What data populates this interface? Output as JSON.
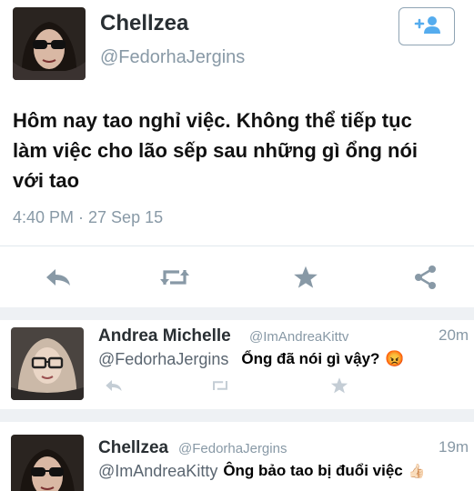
{
  "main_tweet": {
    "author_name": "Chellzea",
    "author_handle": "@FedorhaJergins",
    "text_line1": "Hôm nay tao nghỉ việc. Không thể tiếp tục",
    "text_line2": "làm việc cho lão sếp sau những gì ổng nói",
    "text_line3": "với tao",
    "timestamp": "4:40 PM · 27 Sep 15",
    "follow_icon": "plus-user-icon",
    "actions": [
      "reply-icon",
      "retweet-icon",
      "favorite-icon",
      "share-icon"
    ]
  },
  "replies": [
    {
      "author_name": "Andrea Michelle",
      "author_handle": "@ImAndreaKittv",
      "time": "20m",
      "mention": "@FedorhaJergins",
      "caption": "Ổng đã nói gì vậy?",
      "emoji": "😡"
    },
    {
      "author_name": "Chellzea",
      "author_handle": "@FedorhaJergins",
      "time": "19m",
      "mention": "@ImAndreaKitty",
      "caption": "Ông bảo tao bị đuổi việc",
      "emoji": "👍🏻"
    }
  ],
  "colors": {
    "icon_gray": "#8899a6",
    "text_dark": "#292f33",
    "handle_gray": "#8899a6",
    "follow_blue": "#55acee"
  }
}
